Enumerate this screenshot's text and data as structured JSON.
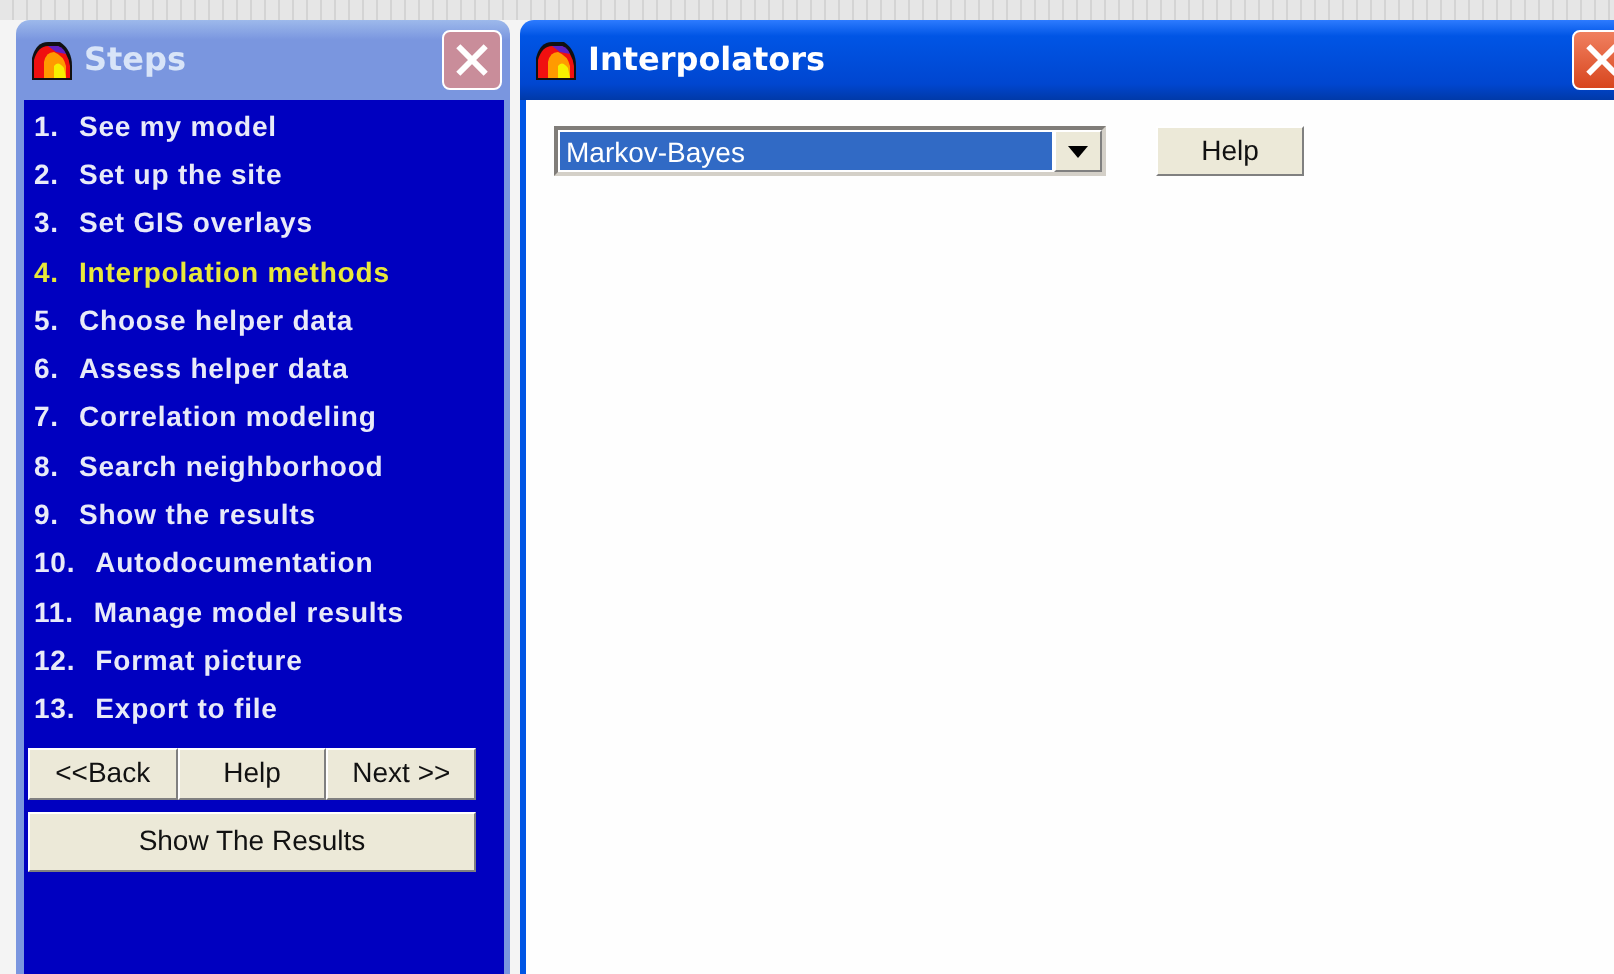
{
  "steps_window": {
    "title": "Steps",
    "active": false,
    "steps": [
      {
        "number": "1.",
        "label": "See my model",
        "selected": false
      },
      {
        "number": "2.",
        "label": "Set up the site",
        "selected": false
      },
      {
        "number": "3.",
        "label": "Set GIS overlays",
        "selected": false
      },
      {
        "number": "4.",
        "label": "Interpolation methods",
        "selected": true
      },
      {
        "number": "5.",
        "label": "Choose helper data",
        "selected": false
      },
      {
        "number": "6.",
        "label": "Assess helper data",
        "selected": false
      },
      {
        "number": "7.",
        "label": "Correlation modeling",
        "selected": false
      },
      {
        "number": "8.",
        "label": "Search neighborhood",
        "selected": false
      },
      {
        "number": "9.",
        "label": "Show the results",
        "selected": false
      },
      {
        "number": "10.",
        "label": "Autodocumentation",
        "selected": false
      },
      {
        "number": "11.",
        "label": "Manage model results",
        "selected": false
      },
      {
        "number": "12.",
        "label": "Format picture",
        "selected": false
      },
      {
        "number": "13.",
        "label": "Export to file",
        "selected": false
      }
    ],
    "nav_buttons": [
      "<<Back",
      "Help",
      "Next >>"
    ],
    "show_button": "Show The Results"
  },
  "interpolators_window": {
    "title": "Interpolators",
    "active": true,
    "method_select": {
      "value": "Markov-Bayes"
    },
    "help_button": "Help"
  }
}
